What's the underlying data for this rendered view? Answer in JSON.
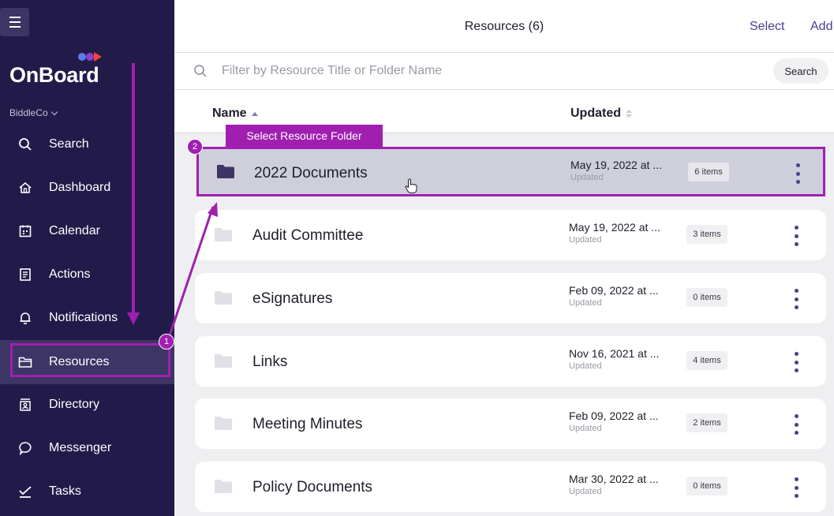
{
  "sidebar": {
    "brand": "OnBoard",
    "org": "BiddleCo",
    "items": [
      {
        "label": "Search",
        "icon": "search-icon"
      },
      {
        "label": "Dashboard",
        "icon": "home-icon"
      },
      {
        "label": "Calendar",
        "icon": "calendar-icon"
      },
      {
        "label": "Actions",
        "icon": "clipboard-icon"
      },
      {
        "label": "Notifications",
        "icon": "bell-icon"
      },
      {
        "label": "Resources",
        "icon": "folder-icon",
        "active": true
      },
      {
        "label": "Directory",
        "icon": "directory-icon"
      },
      {
        "label": "Messenger",
        "icon": "chat-icon"
      },
      {
        "label": "Tasks",
        "icon": "check-icon"
      }
    ]
  },
  "header": {
    "title": "Resources (6)",
    "select_label": "Select",
    "add_label": "Add"
  },
  "filter": {
    "placeholder": "Filter by Resource Title or Folder Name",
    "search_label": "Search"
  },
  "columns": {
    "name": "Name",
    "updated": "Updated"
  },
  "rows": [
    {
      "name": "2022 Documents",
      "date": "May 19, 2022 at ...",
      "sub": "Updated",
      "count": "6 items",
      "selected": true
    },
    {
      "name": "Audit Committee",
      "date": "May 19, 2022 at ...",
      "sub": "Updated",
      "count": "3 items"
    },
    {
      "name": "eSignatures",
      "date": "Feb 09, 2022 at ...",
      "sub": "Updated",
      "count": "0 items"
    },
    {
      "name": "Links",
      "date": "Nov 16, 2021 at ...",
      "sub": "Updated",
      "count": "4 items"
    },
    {
      "name": "Meeting Minutes",
      "date": "Feb 09, 2022 at ...",
      "sub": "Updated",
      "count": "2 items"
    },
    {
      "name": "Policy Documents",
      "date": "Mar 30, 2022 at ...",
      "sub": "Updated",
      "count": "0 items"
    }
  ],
  "annotations": {
    "tooltip": "Select Resource Folder",
    "step1": "1",
    "step2": "2"
  },
  "colors": {
    "sidebar_bg": "#221b4a",
    "accent": "#4a3f8e",
    "annotation": "#a01fb0",
    "logo_dot_blue": "#5b7cf0",
    "logo_dot_purple": "#8b3fd0",
    "logo_dot_red": "#f0453a"
  }
}
